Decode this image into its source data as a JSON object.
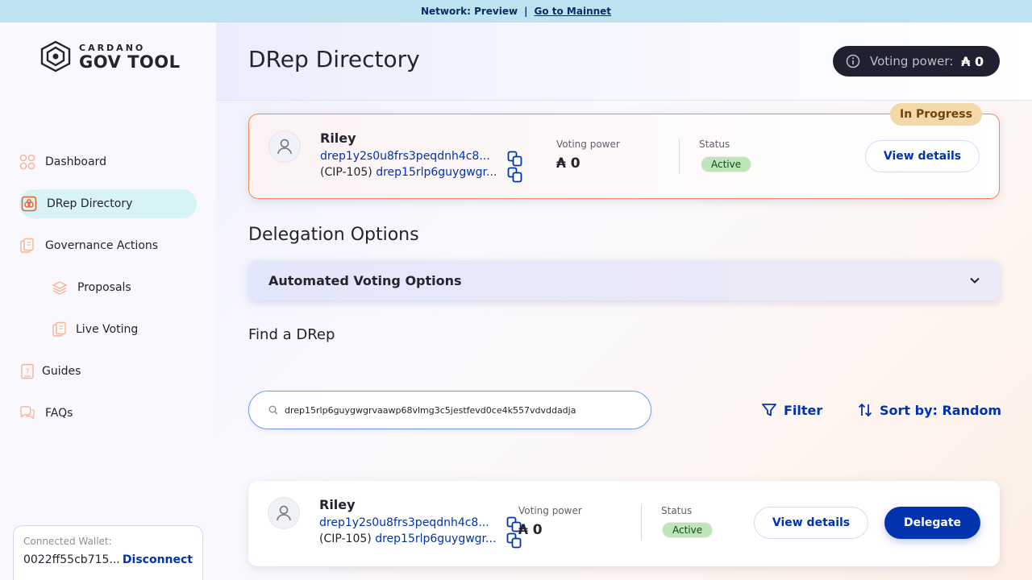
{
  "banner": {
    "network_text": "Network: Preview",
    "separator": "|",
    "link_label": "Go to Mainnet"
  },
  "logo": {
    "top": "CARDANO",
    "bottom": "GOV TOOL"
  },
  "sidebar": {
    "items": [
      {
        "label": "Dashboard",
        "icon": "dashboard-icon"
      },
      {
        "label": "DRep Directory",
        "icon": "drep-directory-icon",
        "active": true
      },
      {
        "label": "Governance Actions",
        "icon": "governance-actions-icon"
      },
      {
        "label": "Proposals",
        "icon": "proposals-icon"
      },
      {
        "label": "Live Voting",
        "icon": "live-voting-icon"
      },
      {
        "label": "Guides",
        "icon": "guides-icon"
      },
      {
        "label": "FAQs",
        "icon": "faqs-icon"
      }
    ]
  },
  "wallet": {
    "label": "Connected Wallet:",
    "address": "0022ff55cb715...",
    "disconnect_label": "Disconnect"
  },
  "header": {
    "title": "DRep Directory",
    "voting_power_label": "Voting power:",
    "voting_power_value": "₳ 0"
  },
  "my_drep": {
    "badge": "In Progress",
    "name": "Riley",
    "id": "drep1y2s0u8frs3peqdnh4c8...",
    "cip_prefix": "(CIP-105)",
    "cip_id": "drep15rlp6guygwgr...",
    "voting_power_label": "Voting power",
    "voting_power_value": "₳ 0",
    "status_label": "Status",
    "status_value": "Active",
    "view_details_label": "View details"
  },
  "delegation": {
    "title": "Delegation Options",
    "automated_label": "Automated Voting Options"
  },
  "find": {
    "title": "Find a DRep",
    "search_value": "drep15rlp6guygwgrvaawp68vlmg3c5jestfevd0ce4k557vdvddadja",
    "filter_label": "Filter",
    "sort_label": "Sort by: Random"
  },
  "result": {
    "name": "Riley",
    "id": "drep1y2s0u8frs3peqdnh4c8...",
    "cip_prefix": "(CIP-105)",
    "cip_id": "drep15rlp6guygwgr...",
    "voting_power_label": "Voting power",
    "voting_power_value": "₳ 0",
    "status_label": "Status",
    "status_value": "Active",
    "view_details_label": "View details",
    "delegate_label": "Delegate"
  },
  "colors": {
    "primary": "#0033ad",
    "accent_orange": "#f18a55",
    "active_green": "#c0e4ba",
    "banner": "#bde3f0"
  }
}
